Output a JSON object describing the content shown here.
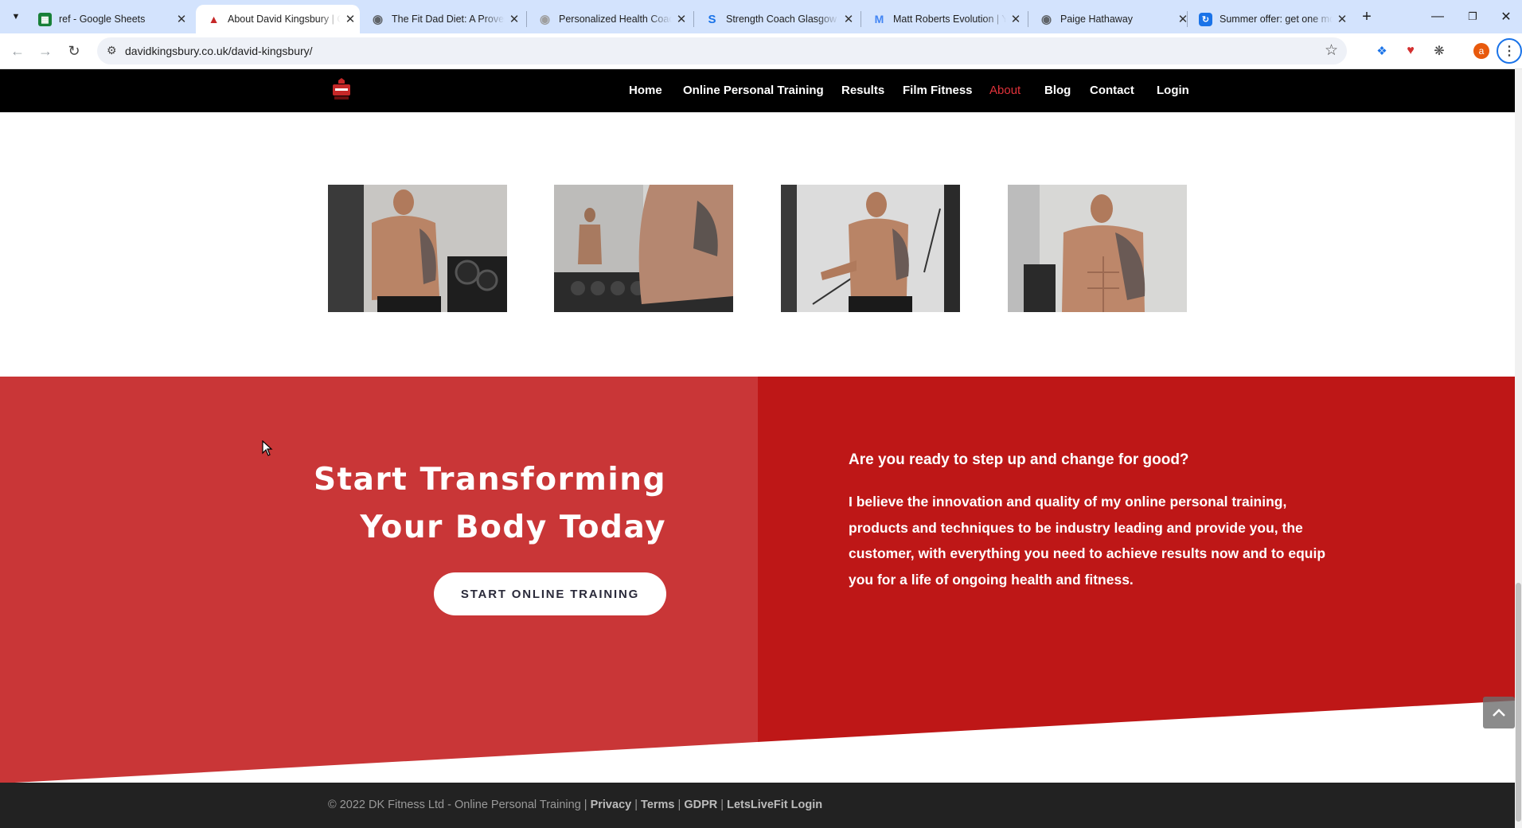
{
  "browser": {
    "tabs": [
      {
        "title": "ref - Google Sheets",
        "icon": "google-sheets-icon",
        "color": "#188038",
        "active": false
      },
      {
        "title": "About David Kingsbury | Online Personal Training",
        "icon": "dk-fitness-icon",
        "color": "#c62828",
        "active": true
      },
      {
        "title": "The Fit Dad Diet: A Proven Plan",
        "icon": "globe-icon",
        "color": "#5f6368",
        "active": false
      },
      {
        "title": "Personalized Health Coaching",
        "icon": "globe-icon",
        "color": "#9e9e9e",
        "active": false
      },
      {
        "title": "Strength Coach Glasgow",
        "icon": "strength-coach-icon",
        "color": "#1a73e8",
        "active": false
      },
      {
        "title": "Matt Roberts Evolution | Your",
        "icon": "matt-roberts-icon",
        "color": "#4285f4",
        "active": false
      },
      {
        "title": "Paige Hathaway",
        "icon": "globe-icon",
        "color": "#5f6368",
        "active": false
      },
      {
        "title": "Summer offer: get one month",
        "icon": "summer-offer-icon",
        "color": "#1a73e8",
        "active": false
      }
    ],
    "url": "davidkingsbury.co.uk/david-kingsbury/",
    "profile_initial": "a"
  },
  "site": {
    "nav": [
      {
        "label": "Home",
        "active": false
      },
      {
        "label": "Online Personal Training",
        "active": false
      },
      {
        "label": "Results",
        "active": false
      },
      {
        "label": "Film Fitness",
        "active": false
      },
      {
        "label": "About",
        "active": true
      },
      {
        "label": "Blog",
        "active": false
      },
      {
        "label": "Contact",
        "active": false
      },
      {
        "label": "Login",
        "active": false
      }
    ],
    "cta": {
      "title_line1": "Start Transforming",
      "title_line2": "Your Body Today",
      "button": "START ONLINE TRAINING",
      "question": "Are you ready to step up and change for good?",
      "body": "I believe the innovation and quality of my online personal training, products and techniques to be industry leading and provide you, the customer, with everything you need to achieve results now and to equip you for a life of ongoing health and fitness."
    },
    "footer": {
      "copyright": "© 2022 DK Fitness Ltd - Online Personal Training |",
      "links": [
        "Privacy",
        "Terms",
        "GDPR",
        "LetsLiveFit Login"
      ],
      "separator": "|"
    }
  },
  "colors": {
    "cta_red": "#be1717",
    "cta_red_light": "#c93637",
    "nav_active": "#e1323a",
    "header_bg": "#000000",
    "footer_bg": "#222222"
  }
}
